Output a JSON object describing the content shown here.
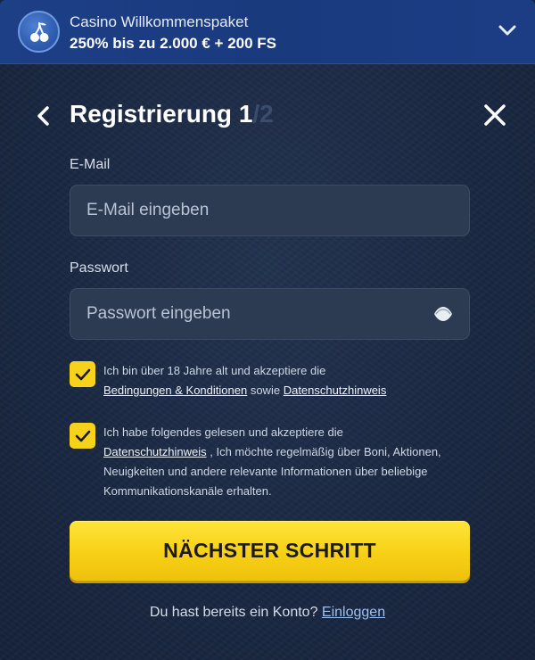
{
  "promo": {
    "title": "Casino Willkommenspaket",
    "subtitle": "250% bis zu 2.000 € + 200 FS",
    "icon": "cherry-icon"
  },
  "header": {
    "title": "Registrierung",
    "step_current": "1",
    "step_total": "/2"
  },
  "form": {
    "email": {
      "label": "E-Mail",
      "placeholder": "E-Mail eingeben",
      "value": ""
    },
    "password": {
      "label": "Passwort",
      "placeholder": "Passwort eingeben",
      "value": ""
    }
  },
  "consents": [
    {
      "checked": true,
      "text_1": "Ich bin über 18 Jahre alt und akzeptiere die",
      "link_1": "Bedingungen & Konditionen",
      "text_2": "sowie",
      "link_2": "Datenschutzhinweis"
    },
    {
      "checked": true,
      "text_1": "Ich habe folgendes gelesen und akzeptiere die",
      "link_1": "Datenschutzhinweis",
      "text_2": ", Ich möchte regelmäßig über Boni, Aktionen, Neuigkeiten und andere relevante Informationen über beliebige Kommunikationskanäle erhalten."
    }
  ],
  "cta": {
    "label": "NÄCHSTER SCHRITT"
  },
  "login": {
    "text": "Du hast bereits ein Konto?",
    "link": "Einloggen"
  },
  "colors": {
    "accent_yellow": "#f7d21a",
    "promo_blue": "#1d3f86",
    "background": "#1a2842",
    "field_bg": "#2c3a52"
  }
}
